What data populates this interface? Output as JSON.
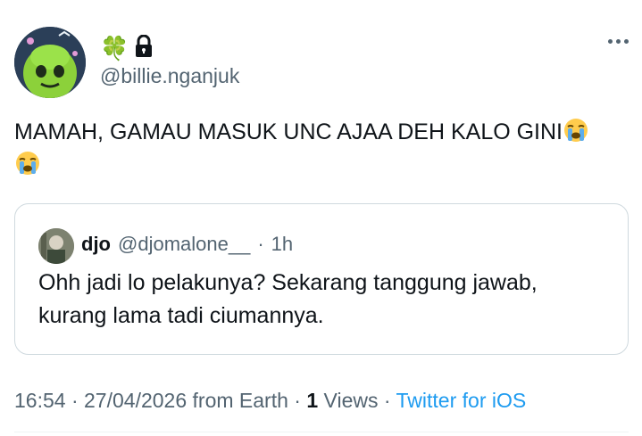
{
  "author": {
    "name_emoji": "🍀",
    "handle": "@billie.nganjuk",
    "lock_icon": "lock-icon"
  },
  "tweet": {
    "text": "MAMAH, GAMAU MASUK UNC AJAA DEH KALO GINI",
    "emoji_icon": "loudly-crying-face-icon"
  },
  "quote": {
    "name": "djo",
    "handle": "@djomalone__",
    "separator": "·",
    "time": "1h",
    "text": "Ohh jadi lo pelakunya? Sekarang tanggung jawab, kurang lama tadi ciumannya."
  },
  "meta": {
    "time": "16:54",
    "sep": "·",
    "date_location": "27/04/2026 from Earth",
    "views_count": "1",
    "views_label": "Views",
    "source": "Twitter for iOS"
  },
  "colors": {
    "text": "#0f1419",
    "secondary": "#536471",
    "link": "#1d9bf0",
    "border": "#cfd9de"
  }
}
